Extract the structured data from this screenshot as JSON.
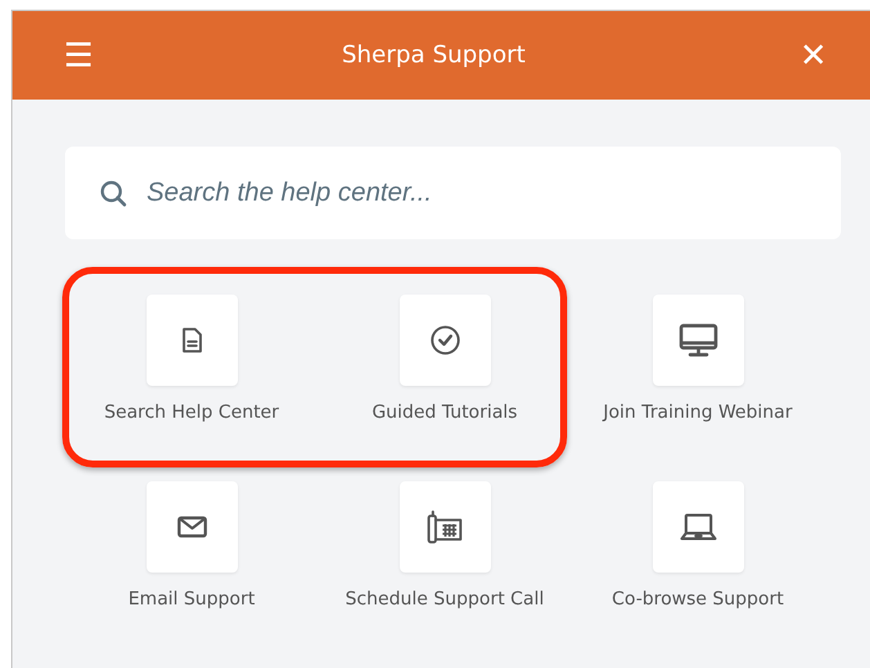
{
  "header": {
    "menu_icon": "☰",
    "title": "Sherpa Support",
    "close_icon": "✕"
  },
  "search": {
    "placeholder": "Search the help center..."
  },
  "tiles": [
    {
      "kind": "document",
      "label": "Search Help Center",
      "highlighted": true
    },
    {
      "kind": "check",
      "label": "Guided Tutorials",
      "highlighted": true
    },
    {
      "kind": "monitor",
      "label": "Join Training Webinar",
      "highlighted": false
    },
    {
      "kind": "mail",
      "label": "Email Support",
      "highlighted": false
    },
    {
      "kind": "phone",
      "label": "Schedule Support Call",
      "highlighted": false
    },
    {
      "kind": "laptop",
      "label": "Co-browse Support",
      "highlighted": false
    }
  ]
}
